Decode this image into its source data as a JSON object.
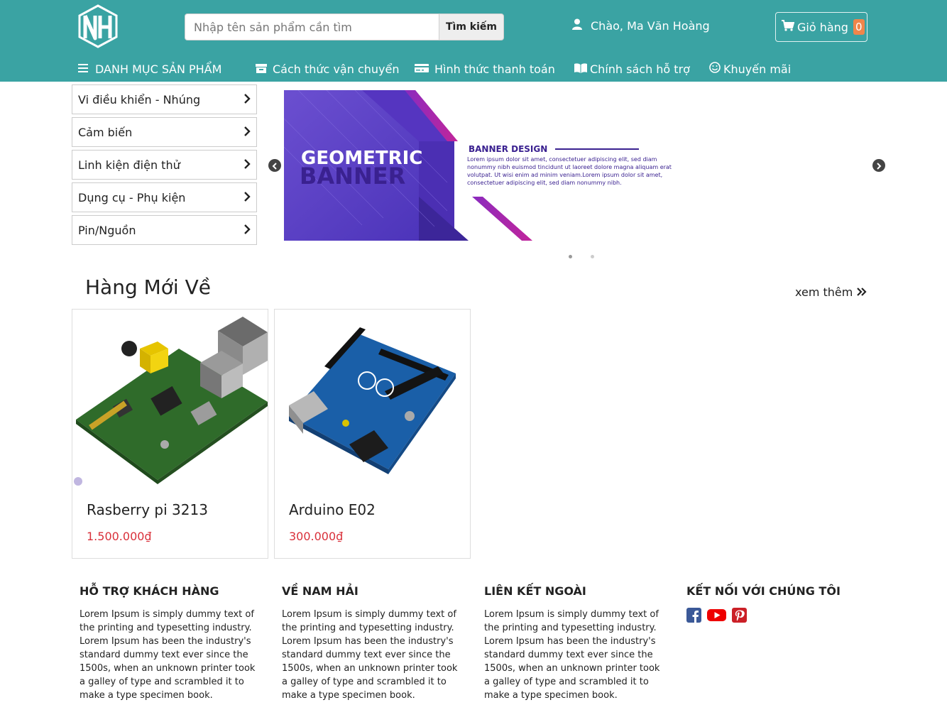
{
  "header": {
    "logo_text": "NH",
    "search_placeholder": "Nhập tên sản phẩm cần tìm",
    "search_button": "Tìm kiếm",
    "greeting": "Chào, Ma Văn Hoàng",
    "cart_label": "Giỏ hàng",
    "cart_count": "0"
  },
  "nav": {
    "categories": "DANH MỤC SẢN PHẨM",
    "shipping": "Cách thức vận chuyển",
    "payment": "Hình thức thanh toán",
    "support": "Chính sách hỗ trợ",
    "promo": "Khuyến mãi"
  },
  "sidebar": {
    "items": [
      {
        "label": "Vi điều khiển - Nhúng"
      },
      {
        "label": "Cảm biến"
      },
      {
        "label": "Linh kiện điện thử"
      },
      {
        "label": "Dụng cụ - Phụ kiện"
      },
      {
        "label": "Pin/Nguồn"
      }
    ]
  },
  "banner": {
    "title1": "GEOMETRIC",
    "title2": "BANNER",
    "heading": "BANNER DESIGN",
    "body": "Lorem ipsum dolor sit amet, consectetuer adipiscing elit, sed diam nonummy nibh euismod tincidunt ut laoreet dolore magna aliquam erat volutpat. Ut wisi enim ad minim veniam.Lorem ipsum dolor sit amet, consectetuer adipiscing elit, sed diam nonummy nibh.",
    "colors": {
      "primary": "#5a3fc0",
      "accent": "#c2259a"
    }
  },
  "section": {
    "title": "Hàng Mới Về",
    "see_more": "xem thêm"
  },
  "products": [
    {
      "name": "Rasberry pi 3213",
      "price": "1.500.000₫"
    },
    {
      "name": "Arduino E02",
      "price": "300.000₫"
    }
  ],
  "footer": {
    "cols": [
      {
        "title": "HỖ TRỢ KHÁCH HÀNG",
        "text": "Lorem Ipsum is simply dummy text of the printing and typesetting industry. Lorem Ipsum has been the industry's standard dummy text ever since the 1500s, when an unknown printer took a galley of type and scrambled it to make a type specimen book."
      },
      {
        "title": "VỀ NAM HẢI",
        "text": "Lorem Ipsum is simply dummy text of the printing and typesetting industry. Lorem Ipsum has been the industry's standard dummy text ever since the 1500s, when an unknown printer took a galley of type and scrambled it to make a type specimen book."
      },
      {
        "title": "LIÊN KẾT NGOÀI",
        "text": "Lorem Ipsum is simply dummy text of the printing and typesetting industry. Lorem Ipsum has been the industry's standard dummy text ever since the 1500s, when an unknown printer took a galley of type and scrambled it to make a type specimen book."
      },
      {
        "title": "KẾT NỐI VỚI CHÚNG TÔI"
      }
    ],
    "socials": [
      "facebook-icon",
      "youtube-icon",
      "pinterest-icon"
    ]
  },
  "theme": {
    "header_bg": "#3aa3a3",
    "price_color": "#d9303a",
    "badge_color": "#f0854a"
  }
}
